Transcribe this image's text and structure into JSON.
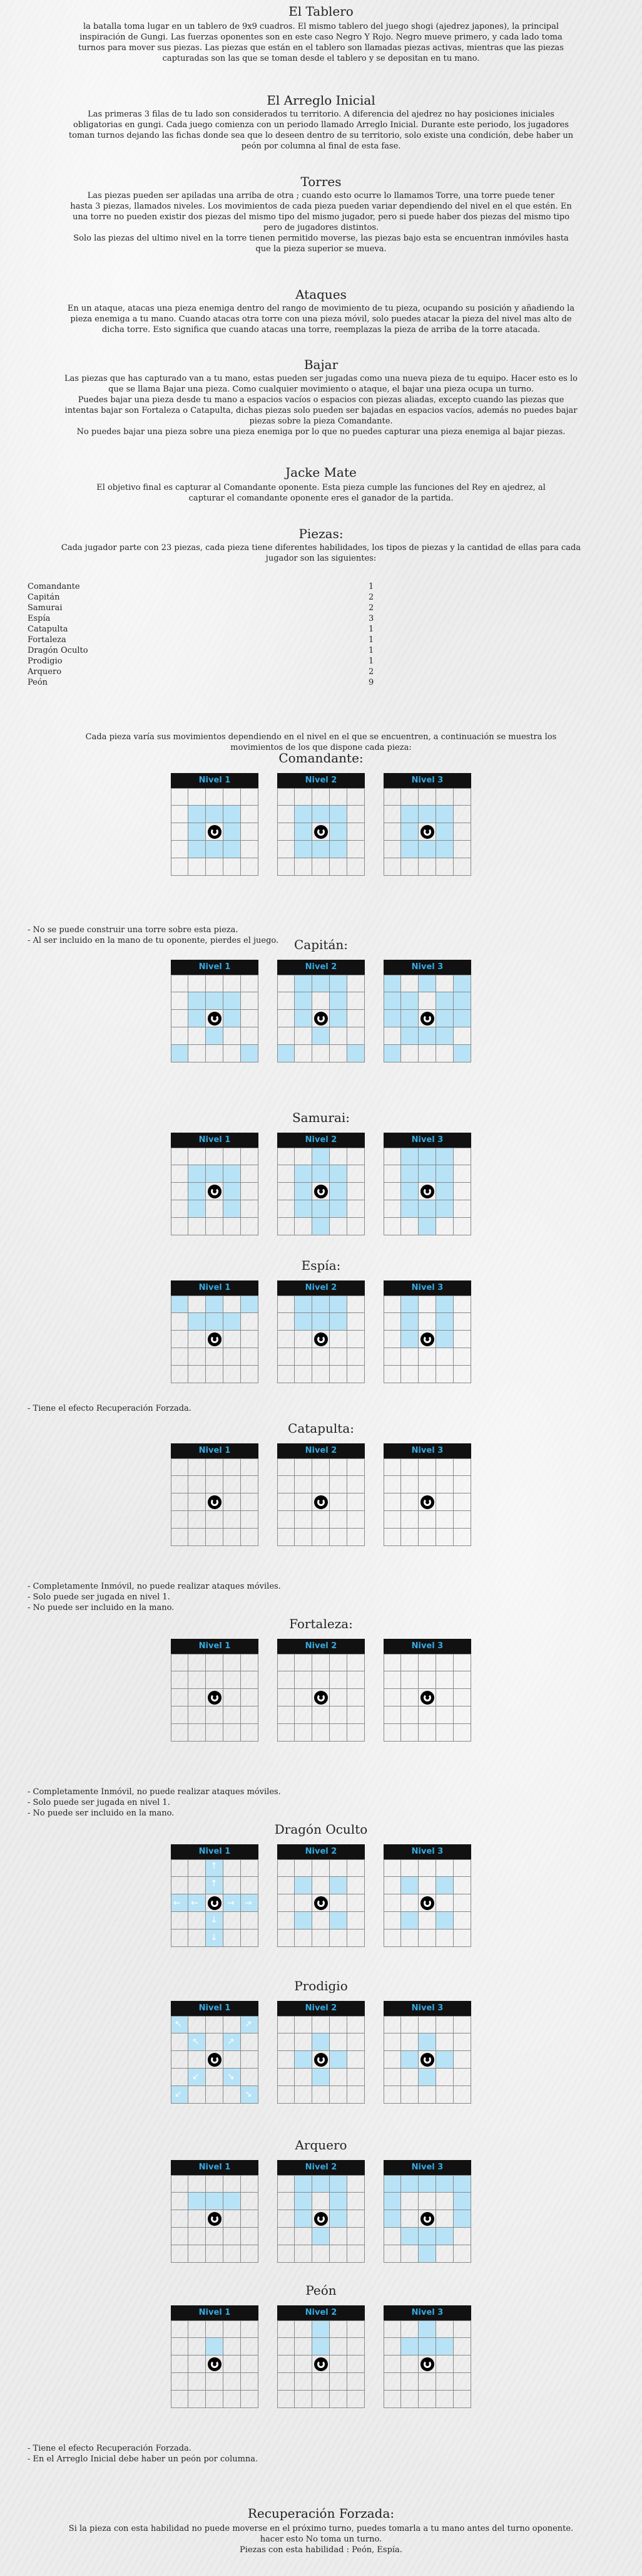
{
  "sections": {
    "tablero": {
      "title": "El Tablero",
      "lines": [
        "la batalla toma lugar en un tablero de 9x9 cuadros. El mismo tablero del juego shogi (ajedrez japones), la principal",
        "inspiración de Gungi. Las fuerzas oponentes son en este caso Negro Y Rojo. Negro mueve primero, y cada lado toma",
        "turnos para mover sus piezas. Las piezas que están en el tablero son llamadas piezas activas, mientras que las piezas",
        "capturadas son las que se toman desde el tablero y se depositan en tu mano."
      ]
    },
    "arreglo": {
      "title": "El Arreglo Inicial",
      "lines": [
        "Las primeras 3 filas de tu lado son considerados tu territorio. A diferencia del ajedrez no hay posiciones iniciales",
        "obligatorias en gungi. Cada juego comienza con un periodo llamado Arreglo Inicial. Durante este periodo, los jugadores",
        "toman turnos dejando las fichas donde sea que lo deseen dentro de su territorio, solo existe una condición, debe haber un",
        "peón por columna al final de esta fase."
      ]
    },
    "torres": {
      "title": "Torres",
      "lines": [
        "Las piezas pueden ser apiladas una arriba de otra  ; cuando esto ocurre lo llamamos Torre, una torre puede tener",
        "hasta 3 piezas, llamados  niveles. Los movimientos de cada pieza pueden variar dependiendo del nivel en el que estén. En",
        "una torre no pueden existir dos piezas del mismo tipo del mismo jugador, pero si puede haber dos piezas del mismo tipo",
        "pero de jugadores distintos.",
        "Solo las piezas del ultimo nivel en la torre tienen permitido moverse, las piezas bajo esta se encuentran inmóviles hasta",
        "que la pieza superior se mueva."
      ]
    },
    "ataques": {
      "title": "Ataques",
      "lines": [
        "En un ataque, atacas una pieza enemiga dentro del rango de movimiento de tu pieza, ocupando su posición y añadiendo la",
        "pieza enemiga a tu mano. Cuando atacas otra torre con una pieza móvil, solo puedes atacar la pieza del nivel mas alto de",
        "dicha torre. Esto significa que cuando atacas una torre, reemplazas la pieza de arriba de la torre atacada."
      ]
    },
    "bajar": {
      "title": "Bajar",
      "lines": [
        "Las piezas que has capturado van a tu mano, estas pueden ser jugadas como una nueva pieza de tu equipo. Hacer esto es lo",
        "que se llama Bajar una pieza. Como cualquier movimiento o ataque, el bajar una pieza ocupa un turno.",
        "Puedes bajar una pieza desde tu mano a espacios vacíos o espacios con piezas aliadas, excepto cuando las piezas  que",
        "intentas bajar son Fortaleza o Catapulta, dichas piezas solo pueden ser bajadas en espacios vacíos, además no puedes bajar",
        "piezas sobre la pieza Comandante.",
        "No puedes bajar una pieza sobre una pieza enemiga por lo que no puedes capturar una pieza enemiga al bajar piezas."
      ]
    },
    "jacke": {
      "title": "Jacke Mate",
      "lines": [
        "El objetivo final  es capturar al Comandante oponente. Esta pieza cumple las funciones del Rey en ajedrez, al",
        "capturar el comandante oponente eres el ganador de la partida."
      ]
    },
    "piezas": {
      "title": "Piezas:",
      "lines": [
        "Cada jugador parte con 23 piezas, cada pieza tiene diferentes habilidades, los tipos de piezas y la cantidad de ellas para cada",
        "jugador son las siguientes:"
      ]
    }
  },
  "piece_table": [
    {
      "name": "Comandante",
      "count": "1"
    },
    {
      "name": "Capitán",
      "count": "2"
    },
    {
      "name": "Samurai",
      "count": "2"
    },
    {
      "name": "Espía",
      "count": "3"
    },
    {
      "name": "Catapulta",
      "count": "1"
    },
    {
      "name": "Fortaleza",
      "count": "1"
    },
    {
      "name": "Dragón Oculto",
      "count": "1"
    },
    {
      "name": "Prodigio",
      "count": "1"
    },
    {
      "name": "Arquero",
      "count": "2"
    },
    {
      "name": "Peón",
      "count": "9"
    }
  ],
  "intro_movs": [
    "Cada pieza varía sus movimientos dependiendo en el nivel en el que se encuentren, a continuación se muestra los",
    "movimientos de los que dispone cada pieza:"
  ],
  "level_labels": [
    "Nivel 1",
    "Nivel 2",
    "Nivel 3"
  ],
  "pieces": {
    "comandante": {
      "title": "Comandante:",
      "notes": [
        "- No se puede construir una torre sobre esta pieza.",
        "- Al ser incluido en la mano de tu oponente, pierdes el juego."
      ]
    },
    "capitan": {
      "title": "Capitán:",
      "notes": []
    },
    "samurai": {
      "title": "Samurai:",
      "notes": []
    },
    "espia": {
      "title": "Espía:",
      "notes": [
        "- Tiene el efecto Recuperación Forzada."
      ]
    },
    "catapulta": {
      "title": "Catapulta:",
      "notes": [
        "- Completamente Inmóvil, no puede realizar ataques móviles.",
        "- Solo puede ser jugada en nivel 1.",
        "- No puede ser incluido en la mano."
      ]
    },
    "fortaleza": {
      "title": "Fortaleza:",
      "notes": [
        "- Completamente Inmóvil, no puede realizar ataques móviles.",
        "- Solo puede ser jugada en nivel 1.",
        "- No puede ser incluido en la mano."
      ]
    },
    "dragon": {
      "title": "Dragón Oculto",
      "notes": []
    },
    "prodigio": {
      "title": "Prodigio",
      "notes": []
    },
    "arquero": {
      "title": "Arquero",
      "notes": []
    },
    "peon": {
      "title": "Peón",
      "notes": [
        "- Tiene el efecto Recuperación Forzada.",
        "- En el Arreglo Inicial debe haber un peón por columna."
      ]
    }
  },
  "recuperacion": {
    "title": "Recuperación Forzada:",
    "lines": [
      "Si la pieza con esta habilidad no puede moverse en el próximo turno, puedes tomarla a tu mano antes del turno oponente.",
      "hacer esto No toma un turno.",
      "Piezas con esta habilidad : Peón, Espía."
    ]
  },
  "colors": {
    "highlight": "#b8e3f6",
    "header_bg": "#111111",
    "header_text": "#36a9e0"
  }
}
